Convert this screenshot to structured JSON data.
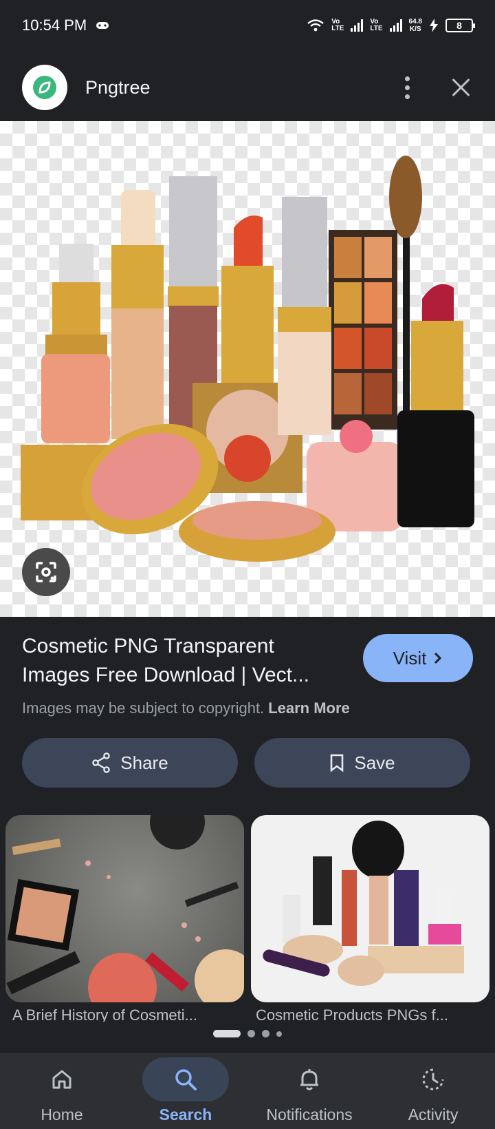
{
  "status": {
    "time": "10:54 PM",
    "lte1": [
      "Vo",
      "LTE"
    ],
    "lte2": [
      "Vo",
      "LTE"
    ],
    "speed_value": "64.8",
    "speed_unit": "K/S",
    "battery": "8"
  },
  "header": {
    "site_name": "Pngtree",
    "icons": {
      "logo": "pngtree-logo",
      "menu": "more-vert-icon",
      "close": "close-icon"
    }
  },
  "hero": {
    "lens_icon": "google-lens-icon"
  },
  "result": {
    "title": "Cosmetic PNG Transparent Images Free Download | Vect...",
    "visit_label": "Visit",
    "copyright_text": "Images may be subject to copyright.",
    "learn_more": "Learn More"
  },
  "actions": {
    "share_label": "Share",
    "save_label": "Save"
  },
  "related": [
    {
      "caption": "A Brief History of Cosmeti..."
    },
    {
      "caption": "Cosmetic Products PNGs f..."
    }
  ],
  "nav": {
    "items": [
      {
        "label": "Home",
        "icon": "home-icon"
      },
      {
        "label": "Search",
        "icon": "search-icon",
        "active": true
      },
      {
        "label": "Notifications",
        "icon": "bell-icon"
      },
      {
        "label": "Activity",
        "icon": "activity-icon"
      }
    ]
  },
  "colors": {
    "accent": "#8ab4f8",
    "background": "#202124",
    "pill": "#3c4658"
  }
}
